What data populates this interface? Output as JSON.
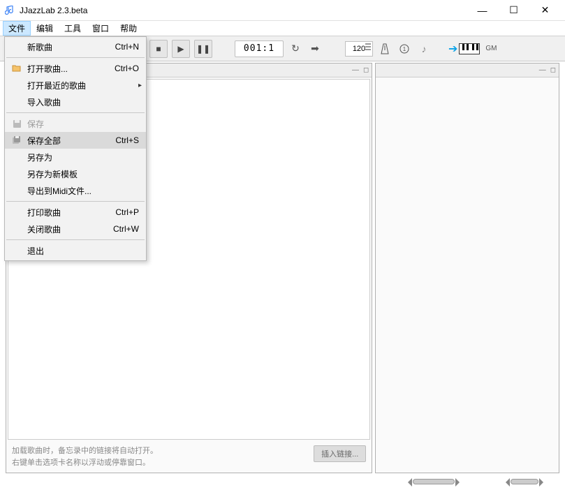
{
  "window": {
    "title": "JJazzLab  2.3.beta"
  },
  "menubar": {
    "items": [
      "文件",
      "编辑",
      "工具",
      "窗口",
      "帮助"
    ]
  },
  "toolbar": {
    "position": "001:1",
    "tempo": "120",
    "gm_label": "GM"
  },
  "file_menu": {
    "new_song": "新歌曲",
    "new_song_key": "Ctrl+N",
    "open_song": "打开歌曲...",
    "open_song_key": "Ctrl+O",
    "recent": "打开最近的歌曲",
    "import": "导入歌曲",
    "save": "保存",
    "save_all": "保存全部",
    "save_all_key": "Ctrl+S",
    "save_as": "另存为",
    "save_as_template": "另存为新模板",
    "export_midi": "导出到Midi文件...",
    "print": "打印歌曲",
    "print_key": "Ctrl+P",
    "close": "关闭歌曲",
    "close_key": "Ctrl+W",
    "exit": "退出"
  },
  "left_panel": {
    "hint_line1": "加载歌曲时，备忘录中的链接将自动打开。",
    "hint_line2": "右键单击选项卡名称以浮动或停靠窗口。",
    "insert_link": "插入链接..."
  }
}
